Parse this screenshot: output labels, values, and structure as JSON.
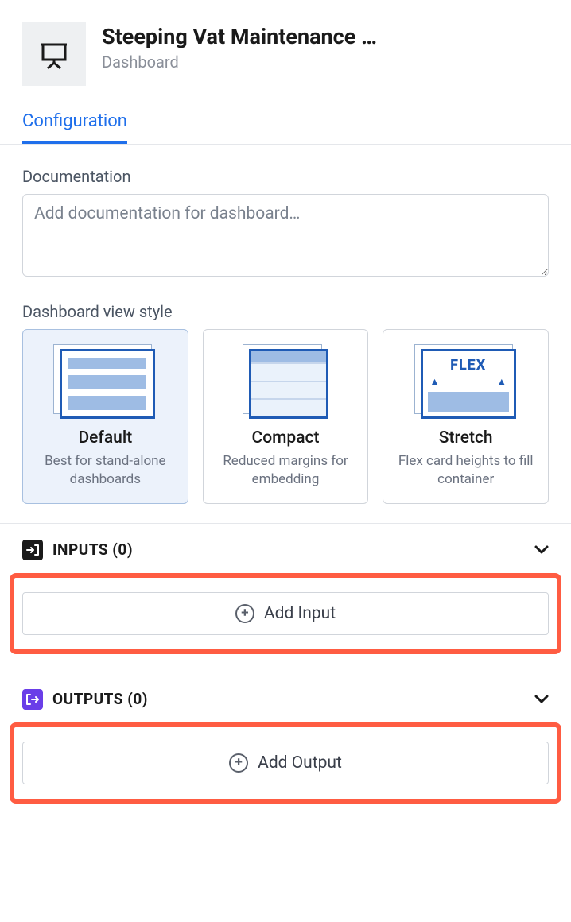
{
  "header": {
    "title": "Steeping Vat Maintenance …",
    "subtitle": "Dashboard"
  },
  "tabs": {
    "configuration": "Configuration"
  },
  "documentation": {
    "label": "Documentation",
    "placeholder": "Add documentation for dashboard…",
    "value": ""
  },
  "viewStyle": {
    "label": "Dashboard view style",
    "options": [
      {
        "title": "Default",
        "desc": "Best for stand-alone dashboards",
        "selected": true
      },
      {
        "title": "Compact",
        "desc": "Reduced margins for embedding",
        "selected": false
      },
      {
        "title": "Stretch",
        "desc": "Flex card heights to fill container",
        "selected": false,
        "flexLabel": "FLEX"
      }
    ]
  },
  "inputs": {
    "title": "INPUTS (0)",
    "addLabel": "Add Input"
  },
  "outputs": {
    "title": "OUTPUTS (0)",
    "addLabel": "Add Output"
  }
}
